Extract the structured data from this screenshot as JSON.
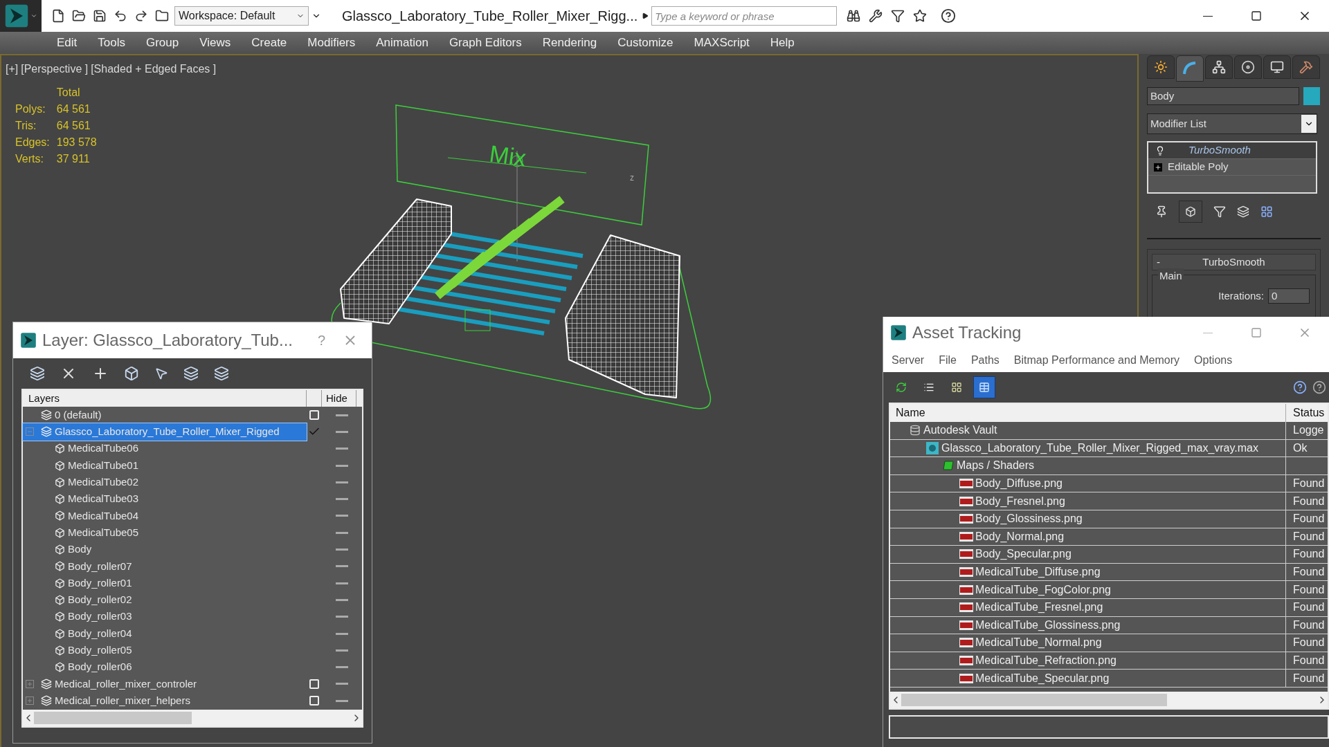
{
  "app": {
    "workspace": "Workspace: Default",
    "title": "Glassco_Laboratory_Tube_Roller_Mixer_Rigg...",
    "search": {
      "placeholder": "Type a keyword or phrase"
    }
  },
  "menu": [
    "Edit",
    "Tools",
    "Group",
    "Views",
    "Create",
    "Modifiers",
    "Animation",
    "Graph Editors",
    "Rendering",
    "Customize",
    "MAXScript",
    "Help"
  ],
  "viewport": {
    "labels": [
      "[+]",
      "[Perspective ]",
      "[Shaded + Edged Faces ]"
    ],
    "stats_header": "Total",
    "stats": [
      {
        "label": "Polys:",
        "value": "64 561"
      },
      {
        "label": "Tris:",
        "value": "64 561"
      },
      {
        "label": "Edges:",
        "value": "193 578"
      },
      {
        "label": "Verts:",
        "value": "37 911"
      }
    ],
    "scene_label": "Mix",
    "axis_label": "z"
  },
  "command_panel": {
    "tabs": [
      {
        "kind": "create",
        "selected": false
      },
      {
        "kind": "modify",
        "selected": true
      },
      {
        "kind": "hierarchy",
        "selected": false
      },
      {
        "kind": "motion",
        "selected": false
      },
      {
        "kind": "display",
        "selected": false
      },
      {
        "kind": "utilities",
        "selected": false
      }
    ],
    "object_name": "Body",
    "modifier_list": "Modifier List",
    "stack": [
      {
        "name": "TurboSmooth",
        "kind": "modifier"
      },
      {
        "name": "Editable Poly",
        "kind": "base"
      }
    ],
    "rollout": {
      "collapse": "-",
      "title": "TurboSmooth",
      "group": "Main",
      "iterations_label": "Iterations:",
      "iterations_value": "0"
    }
  },
  "layer_window": {
    "title": "Layer: Glassco_Laboratory_Tub...",
    "help": "?",
    "columns": [
      "Layers",
      "Hide"
    ],
    "layers": [
      {
        "name": "0 (default)",
        "kind": "layer",
        "selected": false,
        "current": false
      },
      {
        "name": "Glassco_Laboratory_Tube_Roller_Mixer_Rigged",
        "kind": "layer",
        "selected": true,
        "current": true,
        "expanded": true,
        "children": [
          {
            "name": "MedicalTube06",
            "kind": "object"
          },
          {
            "name": "MedicalTube01",
            "kind": "object"
          },
          {
            "name": "MedicalTube02",
            "kind": "object"
          },
          {
            "name": "MedicalTube03",
            "kind": "object"
          },
          {
            "name": "MedicalTube04",
            "kind": "object"
          },
          {
            "name": "MedicalTube05",
            "kind": "object"
          },
          {
            "name": "Body",
            "kind": "object"
          },
          {
            "name": "Body_roller07",
            "kind": "object"
          },
          {
            "name": "Body_roller01",
            "kind": "object"
          },
          {
            "name": "Body_roller02",
            "kind": "object"
          },
          {
            "name": "Body_roller03",
            "kind": "object"
          },
          {
            "name": "Body_roller04",
            "kind": "object"
          },
          {
            "name": "Body_roller05",
            "kind": "object"
          },
          {
            "name": "Body_roller06",
            "kind": "object"
          }
        ]
      },
      {
        "name": "Medical_roller_mixer_controler",
        "kind": "layer",
        "selected": false,
        "current": false,
        "expanded": false
      },
      {
        "name": "Medical_roller_mixer_helpers",
        "kind": "layer",
        "selected": false,
        "current": false,
        "expanded": false
      }
    ]
  },
  "asset_window": {
    "title": "Asset Tracking",
    "menu": [
      "Server",
      "File",
      "Paths",
      "Bitmap Performance and Memory",
      "Options"
    ],
    "toolbar": [
      {
        "kind": "refresh",
        "selected": false
      },
      {
        "kind": "list",
        "selected": false
      },
      {
        "kind": "thumbnails",
        "selected": false
      },
      {
        "kind": "table",
        "selected": true
      }
    ],
    "columns": [
      "Name",
      "Status"
    ],
    "rows": [
      {
        "name": "Autodesk Vault",
        "kind": "vault",
        "status": "Logge",
        "children": [
          {
            "name": "Glassco_Laboratory_Tube_Roller_Mixer_Rigged_max_vray.max",
            "kind": "max",
            "status": "Ok",
            "children": [
              {
                "name": "Maps / Shaders",
                "kind": "maps",
                "children": [
                  {
                    "name": "Body_Diffuse.png",
                    "kind": "png",
                    "status": "Found"
                  },
                  {
                    "name": "Body_Fresnel.png",
                    "kind": "png",
                    "status": "Found"
                  },
                  {
                    "name": "Body_Glossiness.png",
                    "kind": "png",
                    "status": "Found"
                  },
                  {
                    "name": "Body_Normal.png",
                    "kind": "png",
                    "status": "Found"
                  },
                  {
                    "name": "Body_Specular.png",
                    "kind": "png",
                    "status": "Found"
                  },
                  {
                    "name": "MedicalTube_Diffuse.png",
                    "kind": "png",
                    "status": "Found"
                  },
                  {
                    "name": "MedicalTube_FogColor.png",
                    "kind": "png",
                    "status": "Found"
                  },
                  {
                    "name": "MedicalTube_Fresnel.png",
                    "kind": "png",
                    "status": "Found"
                  },
                  {
                    "name": "MedicalTube_Glossiness.png",
                    "kind": "png",
                    "status": "Found"
                  },
                  {
                    "name": "MedicalTube_Normal.png",
                    "kind": "png",
                    "status": "Found"
                  },
                  {
                    "name": "MedicalTube_Refraction.png",
                    "kind": "png",
                    "status": "Found"
                  },
                  {
                    "name": "MedicalTube_Specular.png",
                    "kind": "png",
                    "status": "Found"
                  }
                ]
              }
            ]
          }
        ]
      }
    ]
  }
}
